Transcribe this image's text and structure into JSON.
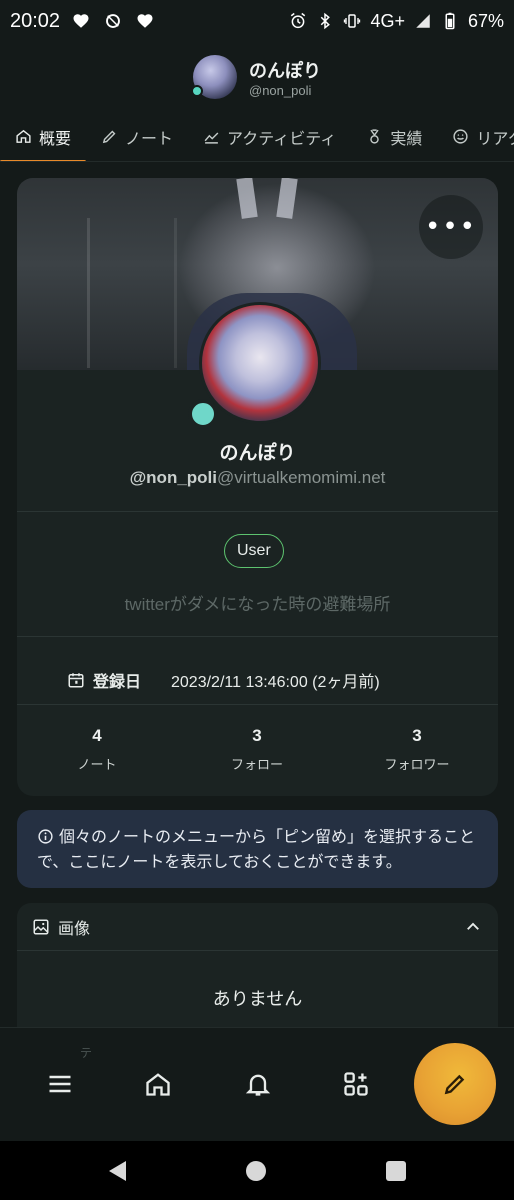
{
  "status_bar": {
    "time": "20:02",
    "network": "4G+",
    "battery": "67%",
    "icons": [
      "heart-icon",
      "data-saver-icon",
      "heart-icon",
      "alarm-icon",
      "bluetooth-icon",
      "vibrate-icon",
      "signal-icon",
      "battery-icon"
    ]
  },
  "header": {
    "name": "のんぽり",
    "handle": "@non_poli"
  },
  "tabs": [
    {
      "label": "概要",
      "icon": "home-icon",
      "active": true
    },
    {
      "label": "ノート",
      "icon": "pencil-icon",
      "active": false
    },
    {
      "label": "アクティビティ",
      "icon": "chart-line-icon",
      "active": false
    },
    {
      "label": "実績",
      "icon": "medal-icon",
      "active": false
    },
    {
      "label": "リアクシ",
      "icon": "smile-icon",
      "active": false
    }
  ],
  "profile": {
    "display_name": "のんぽり",
    "username": "@non_poli",
    "host": "@virtualkemomimi.net",
    "role": "User",
    "bio": "twitterがダメになった時の避難場所",
    "registered_label": "登録日",
    "registered_value": "2023/2/11 13:46:00 (2ヶ月前)",
    "stats": [
      {
        "value": "4",
        "label": "ノート"
      },
      {
        "value": "3",
        "label": "フォロー"
      },
      {
        "value": "3",
        "label": "フォロワー"
      }
    ],
    "more_button": "•••"
  },
  "pinned_info": {
    "text": "個々のノートのメニューから「ピン留め」を選択することで、ここにノートを表示しておくことができます。"
  },
  "images_section": {
    "title": "画像",
    "empty_text": "ありません"
  },
  "bottom_nav": {
    "ghost_text": "テ",
    "items": [
      "menu-icon",
      "home-icon",
      "bell-icon",
      "widgets-icon"
    ],
    "fab": "compose-icon"
  },
  "colors": {
    "accent": "#e88a2a",
    "fab": "#e8a234",
    "online": "#6fd7c9",
    "role_border": "#5dc36f",
    "info_bg": "#253042",
    "card_bg": "#1b2322",
    "page_bg": "#141a19"
  }
}
